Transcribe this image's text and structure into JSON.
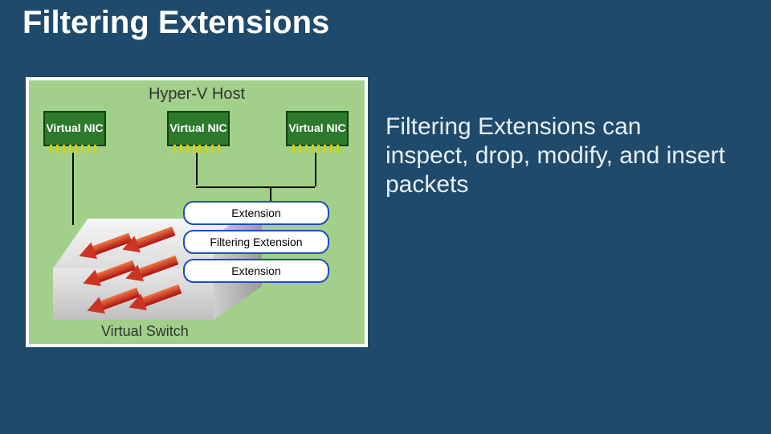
{
  "title": "Filtering Extensions",
  "description": "Filtering Extensions can inspect, drop, modify, and insert packets",
  "diagram": {
    "host_label": "Hyper-V Host",
    "nics": [
      "Virtual NIC",
      "Virtual NIC",
      "Virtual NIC"
    ],
    "extension_pills": [
      "Extension",
      "Filtering Extension",
      "Extension"
    ],
    "switch_label": "Virtual Switch"
  },
  "colors": {
    "background": "#1f4a6b",
    "diagram_bg": "#a2cf8a",
    "nic_fill": "#2d7a2d",
    "pill_border": "#1e4db7",
    "arrow": "#c32"
  },
  "chart_data": {
    "type": "diagram",
    "nodes": [
      {
        "id": "host",
        "label": "Hyper-V Host",
        "kind": "container"
      },
      {
        "id": "nic1",
        "label": "Virtual NIC",
        "kind": "nic"
      },
      {
        "id": "nic2",
        "label": "Virtual NIC",
        "kind": "nic"
      },
      {
        "id": "nic3",
        "label": "Virtual NIC",
        "kind": "nic"
      },
      {
        "id": "ext1",
        "label": "Extension",
        "kind": "extension"
      },
      {
        "id": "ext2",
        "label": "Filtering Extension",
        "kind": "extension",
        "highlight": true
      },
      {
        "id": "ext3",
        "label": "Extension",
        "kind": "extension"
      },
      {
        "id": "vswitch",
        "label": "Virtual Switch",
        "kind": "switch"
      }
    ],
    "edges": [
      {
        "from": "nic1",
        "to": "vswitch"
      },
      {
        "from": "nic2",
        "to": "ext1"
      },
      {
        "from": "nic3",
        "to": "ext1"
      },
      {
        "from": "ext1",
        "to": "ext2"
      },
      {
        "from": "ext2",
        "to": "ext3"
      },
      {
        "from": "ext3",
        "to": "vswitch"
      }
    ],
    "flows": [
      {
        "from": "vswitch",
        "through": [
          "ext3",
          "ext2",
          "ext1"
        ],
        "direction": "bidirectional",
        "arrows": 6
      }
    ]
  }
}
